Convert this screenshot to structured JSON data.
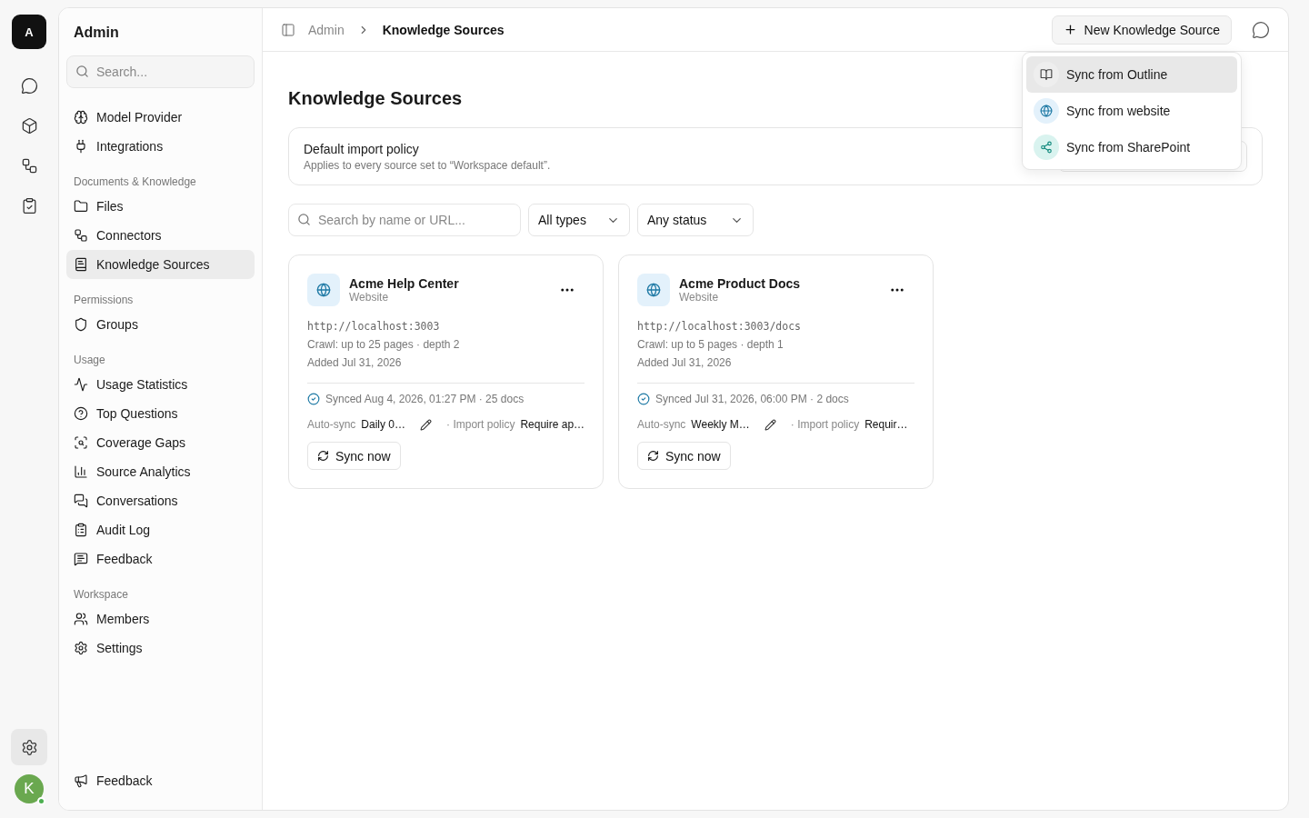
{
  "rail": {
    "logo": "A",
    "settings_selected": true,
    "avatar": "K",
    "online": true
  },
  "sidebar": {
    "title": "Admin",
    "search": {
      "placeholder": "Search..."
    },
    "sections": [
      {
        "items": [
          {
            "label": "Model Provider",
            "selected": false
          },
          {
            "label": "Integrations",
            "selected": false
          }
        ]
      },
      {
        "heading": "Documents & Knowledge",
        "items": [
          {
            "label": "Files",
            "selected": false
          },
          {
            "label": "Connectors",
            "selected": false
          },
          {
            "label": "Knowledge Sources",
            "selected": true
          }
        ]
      },
      {
        "heading": "Permissions",
        "items": [
          {
            "label": "Groups",
            "selected": false
          }
        ]
      },
      {
        "heading": "Usage",
        "items": [
          {
            "label": "Usage Statistics",
            "selected": false
          },
          {
            "label": "Top Questions",
            "selected": false
          },
          {
            "label": "Coverage Gaps",
            "selected": false
          },
          {
            "label": "Source Analytics",
            "selected": false
          },
          {
            "label": "Conversations",
            "selected": false
          },
          {
            "label": "Audit Log",
            "selected": false
          },
          {
            "label": "Feedback",
            "selected": false
          }
        ]
      },
      {
        "heading": "Workspace",
        "items": [
          {
            "label": "Members",
            "selected": false
          },
          {
            "label": "Settings",
            "selected": false
          }
        ]
      }
    ],
    "footer": "Feedback"
  },
  "breadcrumb": [
    "Admin",
    "Knowledge Sources"
  ],
  "new_button": "New Knowledge Source",
  "menu": [
    {
      "kind": "outline",
      "label": "Sync from Outline",
      "selected": true
    },
    {
      "kind": "website",
      "label": "Sync from website",
      "selected": false
    },
    {
      "kind": "sharepoint",
      "label": "Sync from SharePoint",
      "selected": false
    }
  ],
  "page_title": "Knowledge Sources",
  "policy": {
    "title": "Default import policy",
    "description": "Applies to every source set to “Workspace default”."
  },
  "filters": {
    "search": {
      "placeholder": "Search by name or URL..."
    },
    "type": "All types",
    "status": "Any status"
  },
  "sources": [
    {
      "name": "Acme Help Center",
      "type": "Website",
      "url": "http://localhost:3003",
      "crawl": "Crawl: up to 25 pages · depth 2",
      "added": "Added Jul 31, 2026",
      "synced": "Synced Aug 4, 2026, 01:27 PM · 25 docs",
      "auto_sync_label": "Auto-sync",
      "auto_sync": "Daily 0…",
      "policy_label": "· Import policy",
      "policy": "Require ap…",
      "action": "Sync now"
    },
    {
      "name": "Acme Product Docs",
      "type": "Website",
      "url": "http://localhost:3003/docs",
      "crawl": "Crawl: up to 5 pages · depth 1",
      "added": "Added Jul 31, 2026",
      "synced": "Synced Jul 31, 2026, 06:00 PM · 2 docs",
      "auto_sync_label": "Auto-sync",
      "auto_sync": "Weekly M…",
      "policy_label": "· Import policy",
      "policy": "Requir…",
      "action": "Sync now"
    }
  ]
}
